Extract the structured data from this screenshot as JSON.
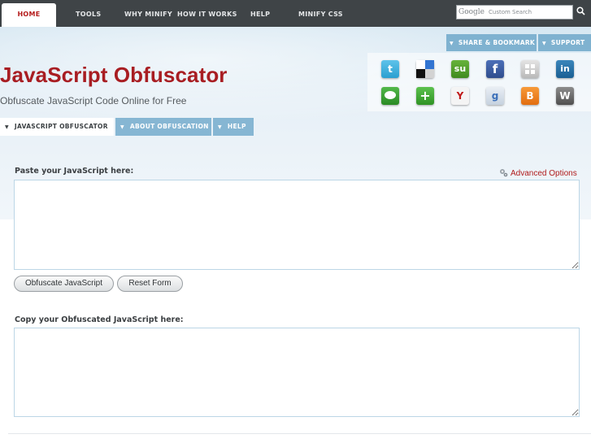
{
  "topnav": {
    "items": [
      "HOME",
      "TOOLS",
      "WHY MINIFY",
      "HOW IT WORKS",
      "HELP",
      "MINIFY CSS"
    ],
    "search": {
      "logo": "Google",
      "placeholder": "Custom Search"
    }
  },
  "share": {
    "share_label": "SHARE & BOOKMARK",
    "support_label": "SUPPORT"
  },
  "social_icons": [
    "twitter-icon",
    "delicious-icon",
    "stumbleupon-icon",
    "facebook-icon",
    "myspace-icon",
    "linkedin-icon",
    "technorati-icon",
    "addthis-icon",
    "yahoo-icon",
    "google-icon",
    "blogger-icon",
    "wordpress-icon"
  ],
  "header": {
    "title": "JavaScript Obfuscator",
    "subtitle": "Obfuscate JavaScript Code Online for Free"
  },
  "tabs": [
    "JAVASCRIPT OBFUSCATOR",
    "ABOUT OBFUSCATION",
    "HELP"
  ],
  "form": {
    "input_label": "Paste your JavaScript here:",
    "advanced_label": "Advanced Options",
    "input_value": "",
    "obfuscate_button": "Obfuscate JavaScript",
    "reset_button": "Reset Form",
    "output_label": "Copy your Obfuscated JavaScript here:",
    "output_value": ""
  },
  "colors": {
    "brand_red": "#a81d22",
    "tab_blue": "#86b6d3",
    "nav_dark": "#3f4447"
  }
}
